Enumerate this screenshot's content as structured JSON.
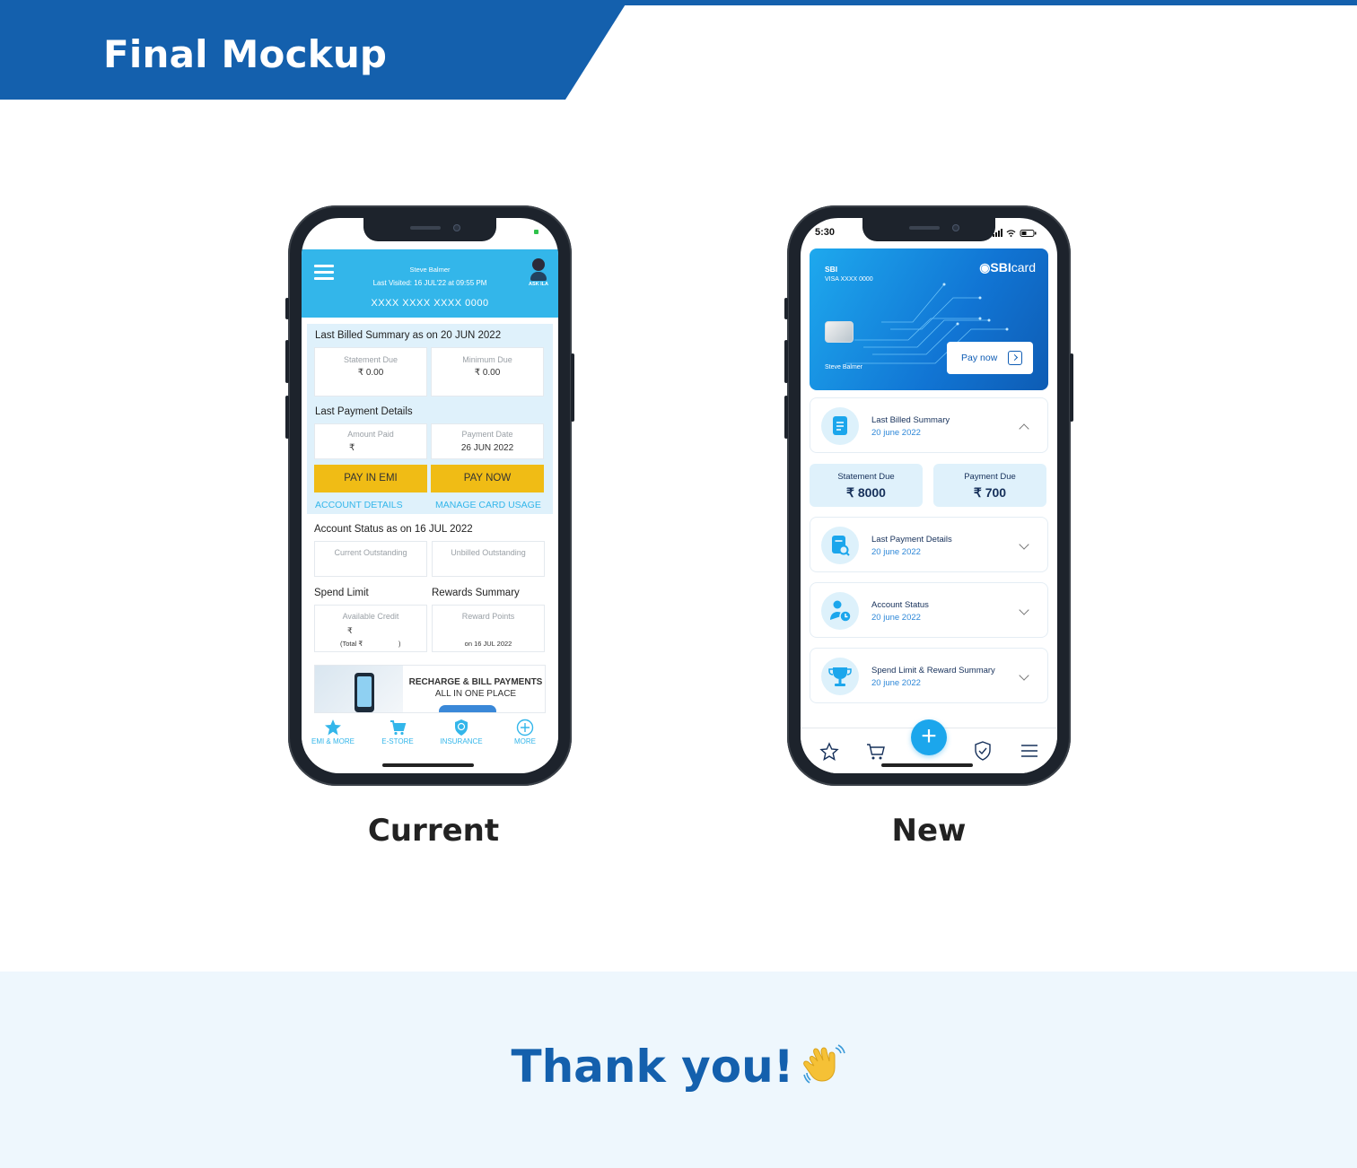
{
  "banner": {
    "title": "Final Mockup"
  },
  "captions": {
    "current": "Current",
    "new": "New"
  },
  "footer": {
    "thank_you": "Thank you!"
  },
  "old_app": {
    "header": {
      "user_name": "Steve Balmer",
      "last_visited": "Last Visited: 16 JUL'22 at 09:55 PM",
      "card_number": "XXXX XXXX XXXX  0000",
      "ask_ila": "ASK ILA"
    },
    "last_billed": {
      "title": "Last Billed Summary as on 20 JUN 2022",
      "statement_due_label": "Statement Due",
      "statement_due_value": "₹ 0.00",
      "minimum_due_label": "Minimum Due",
      "minimum_due_value": "₹ 0.00"
    },
    "last_payment": {
      "title": "Last Payment Details",
      "amount_paid_label": "Amount Paid",
      "amount_paid_value": "₹",
      "payment_date_label": "Payment Date",
      "payment_date_value": "26 JUN 2022"
    },
    "actions": {
      "pay_in_emi": "PAY IN EMI",
      "pay_now": "PAY NOW",
      "account_details": "ACCOUNT DETAILS",
      "manage_card_usage": "MANAGE CARD USAGE"
    },
    "account_status": {
      "title": "Account Status as on 16 JUL 2022",
      "current_outstanding_label": "Current Outstanding",
      "unbilled_outstanding_label": "Unbilled Outstanding"
    },
    "spend_limit": {
      "title": "Spend Limit",
      "available_credit_label": "Available Credit",
      "available_credit_value": "₹",
      "total_label": "(Total ₹",
      "total_close": ")"
    },
    "rewards": {
      "title": "Rewards Summary",
      "reward_points_label": "Reward Points",
      "date_value": "on 16 JUL 2022"
    },
    "ad": {
      "line1": "RECHARGE & BILL PAYMENTS",
      "line2": "ALL IN ONE PLACE"
    },
    "nav": [
      {
        "label": "EMI & MORE",
        "icon": "star-icon"
      },
      {
        "label": "E-STORE",
        "icon": "cart-icon"
      },
      {
        "label": "INSURANCE",
        "icon": "shield-icon"
      },
      {
        "label": "MORE",
        "icon": "plus-circle-icon"
      }
    ],
    "colors": {
      "header": "#33b6ea",
      "button": "#f0bc15",
      "section": "#dff1fb"
    }
  },
  "new_app": {
    "status_time": "5:30",
    "card": {
      "bank": "SBI",
      "network_line": "VISA  XXXX 0000",
      "logo_bold": "SBI",
      "logo_light": "card",
      "holder": "Steve Balmer",
      "pay_now": "Pay now"
    },
    "last_billed": {
      "title": "Last Billed Summary",
      "date": "20 june 2022"
    },
    "dues": {
      "statement_label": "Statement Due",
      "statement_value": "₹ 8000",
      "payment_label": "Payment Due",
      "payment_value": "₹ 700"
    },
    "rows": [
      {
        "title": "Last Payment Details",
        "date": "20 june 2022",
        "icon": "receipt-search-icon"
      },
      {
        "title": "Account Status",
        "date": "20 june 2022",
        "icon": "user-clock-icon"
      },
      {
        "title": "Spend Limit & Reward Summary",
        "date": "20 june 2022",
        "icon": "trophy-icon"
      }
    ],
    "tabs": [
      {
        "icon": "star-icon"
      },
      {
        "icon": "cart-icon"
      },
      {
        "icon": "add-icon"
      },
      {
        "icon": "shield-check-icon"
      },
      {
        "icon": "menu-icon"
      }
    ],
    "colors": {
      "card_start": "#1ea9ee",
      "card_end": "#0e5cb4",
      "accent": "#1ba6ec",
      "tile": "#dff1fb"
    }
  }
}
